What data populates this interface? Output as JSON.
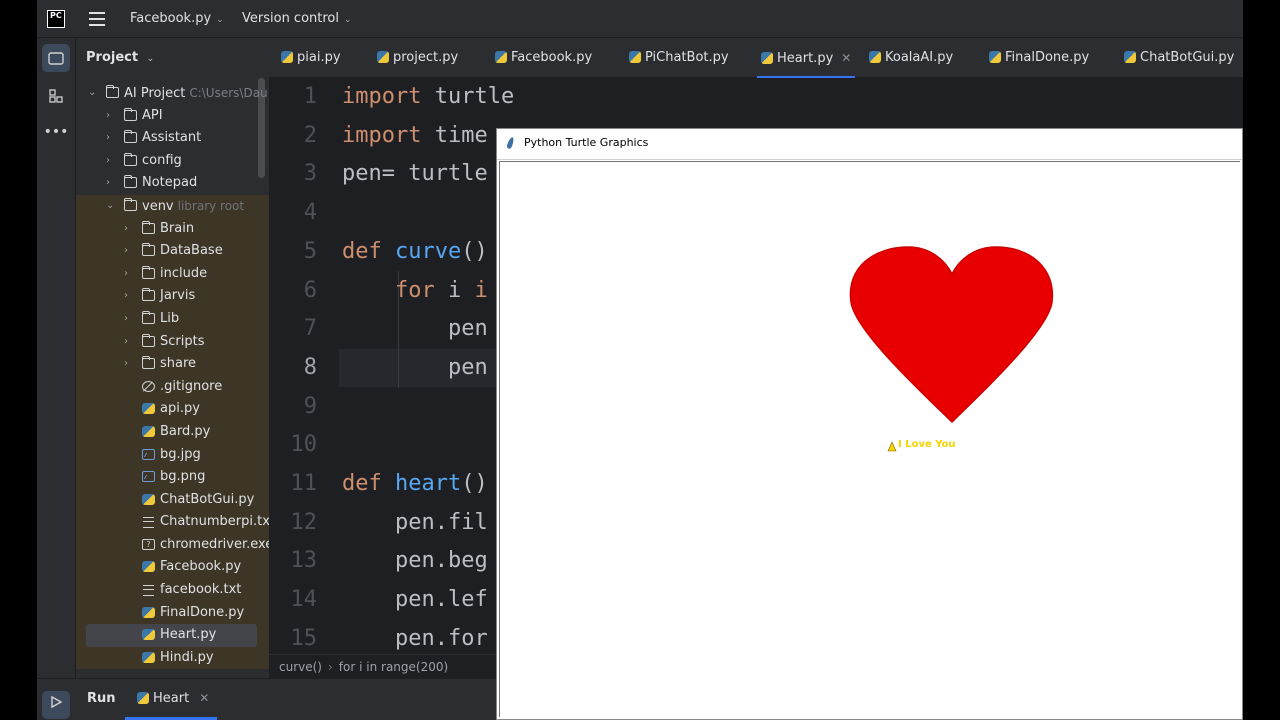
{
  "titlebar": {
    "logo_text": "PC",
    "project_name": "Facebook.py",
    "version_control": "Version control"
  },
  "project_panel": {
    "header": "Project",
    "items": [
      {
        "label": "AI Project",
        "path": "C:\\Users\\Dau",
        "type": "folder",
        "depth": 0,
        "expanded": true
      },
      {
        "label": "API",
        "type": "folder",
        "depth": 1
      },
      {
        "label": "Assistant",
        "type": "folder",
        "depth": 1
      },
      {
        "label": "config",
        "type": "folder",
        "depth": 1
      },
      {
        "label": "Notepad",
        "type": "folder",
        "depth": 1
      },
      {
        "label": "venv",
        "note": "library root",
        "type": "folder",
        "depth": 1,
        "expanded": true
      },
      {
        "label": "Brain",
        "type": "folder",
        "depth": 2
      },
      {
        "label": "DataBase",
        "type": "folder",
        "depth": 2
      },
      {
        "label": "include",
        "type": "folder",
        "depth": 2
      },
      {
        "label": "Jarvis",
        "type": "folder",
        "depth": 2
      },
      {
        "label": "Lib",
        "type": "folder",
        "depth": 2
      },
      {
        "label": "Scripts",
        "type": "folder",
        "depth": 2
      },
      {
        "label": "share",
        "type": "folder",
        "depth": 2
      },
      {
        "label": ".gitignore",
        "type": "ignore",
        "depth": 2
      },
      {
        "label": "api.py",
        "type": "py",
        "depth": 2
      },
      {
        "label": "Bard.py",
        "type": "py",
        "depth": 2
      },
      {
        "label": "bg.jpg",
        "type": "img",
        "depth": 2
      },
      {
        "label": "bg.png",
        "type": "img",
        "depth": 2
      },
      {
        "label": "ChatBotGui.py",
        "type": "py",
        "depth": 2
      },
      {
        "label": "Chatnumberpi.txt",
        "type": "txt",
        "depth": 2
      },
      {
        "label": "chromedriver.exe",
        "type": "exe",
        "depth": 2
      },
      {
        "label": "Facebook.py",
        "type": "py",
        "depth": 2
      },
      {
        "label": "facebook.txt",
        "type": "txt",
        "depth": 2
      },
      {
        "label": "FinalDone.py",
        "type": "py",
        "depth": 2
      },
      {
        "label": "Heart.py",
        "type": "py",
        "depth": 2,
        "selected": true
      },
      {
        "label": "Hindi.py",
        "type": "py",
        "depth": 2
      }
    ]
  },
  "tabs": [
    {
      "label": "piai.py"
    },
    {
      "label": "project.py"
    },
    {
      "label": "Facebook.py"
    },
    {
      "label": "PiChatBot.py"
    },
    {
      "label": "Heart.py",
      "active": true
    },
    {
      "label": "KoalaAI.py"
    },
    {
      "label": "FinalDone.py"
    },
    {
      "label": "ChatBotGui.py"
    }
  ],
  "code_lines": [
    {
      "n": "1",
      "text": "import turtle"
    },
    {
      "n": "2",
      "text": "import time"
    },
    {
      "n": "3",
      "text": "pen= turtle"
    },
    {
      "n": "4",
      "text": ""
    },
    {
      "n": "5",
      "text": "def curve()"
    },
    {
      "n": "6",
      "text": "    for i i"
    },
    {
      "n": "7",
      "text": "        pen"
    },
    {
      "n": "8",
      "text": "        pen"
    },
    {
      "n": "9",
      "text": ""
    },
    {
      "n": "10",
      "text": ""
    },
    {
      "n": "11",
      "text": "def heart()"
    },
    {
      "n": "12",
      "text": "    pen.fil"
    },
    {
      "n": "13",
      "text": "    pen.beg"
    },
    {
      "n": "14",
      "text": "    pen.lef"
    },
    {
      "n": "15",
      "text": "    pen.for"
    }
  ],
  "breadcrumb": {
    "first": "curve()",
    "second": "for i in range(200)"
  },
  "run_panel": {
    "label": "Run",
    "tab": "Heart"
  },
  "turtle_window": {
    "title": "Python Turtle Graphics",
    "heart_color": "#e80000",
    "heart_text": "I Love You",
    "text_color": "#f5d300"
  }
}
